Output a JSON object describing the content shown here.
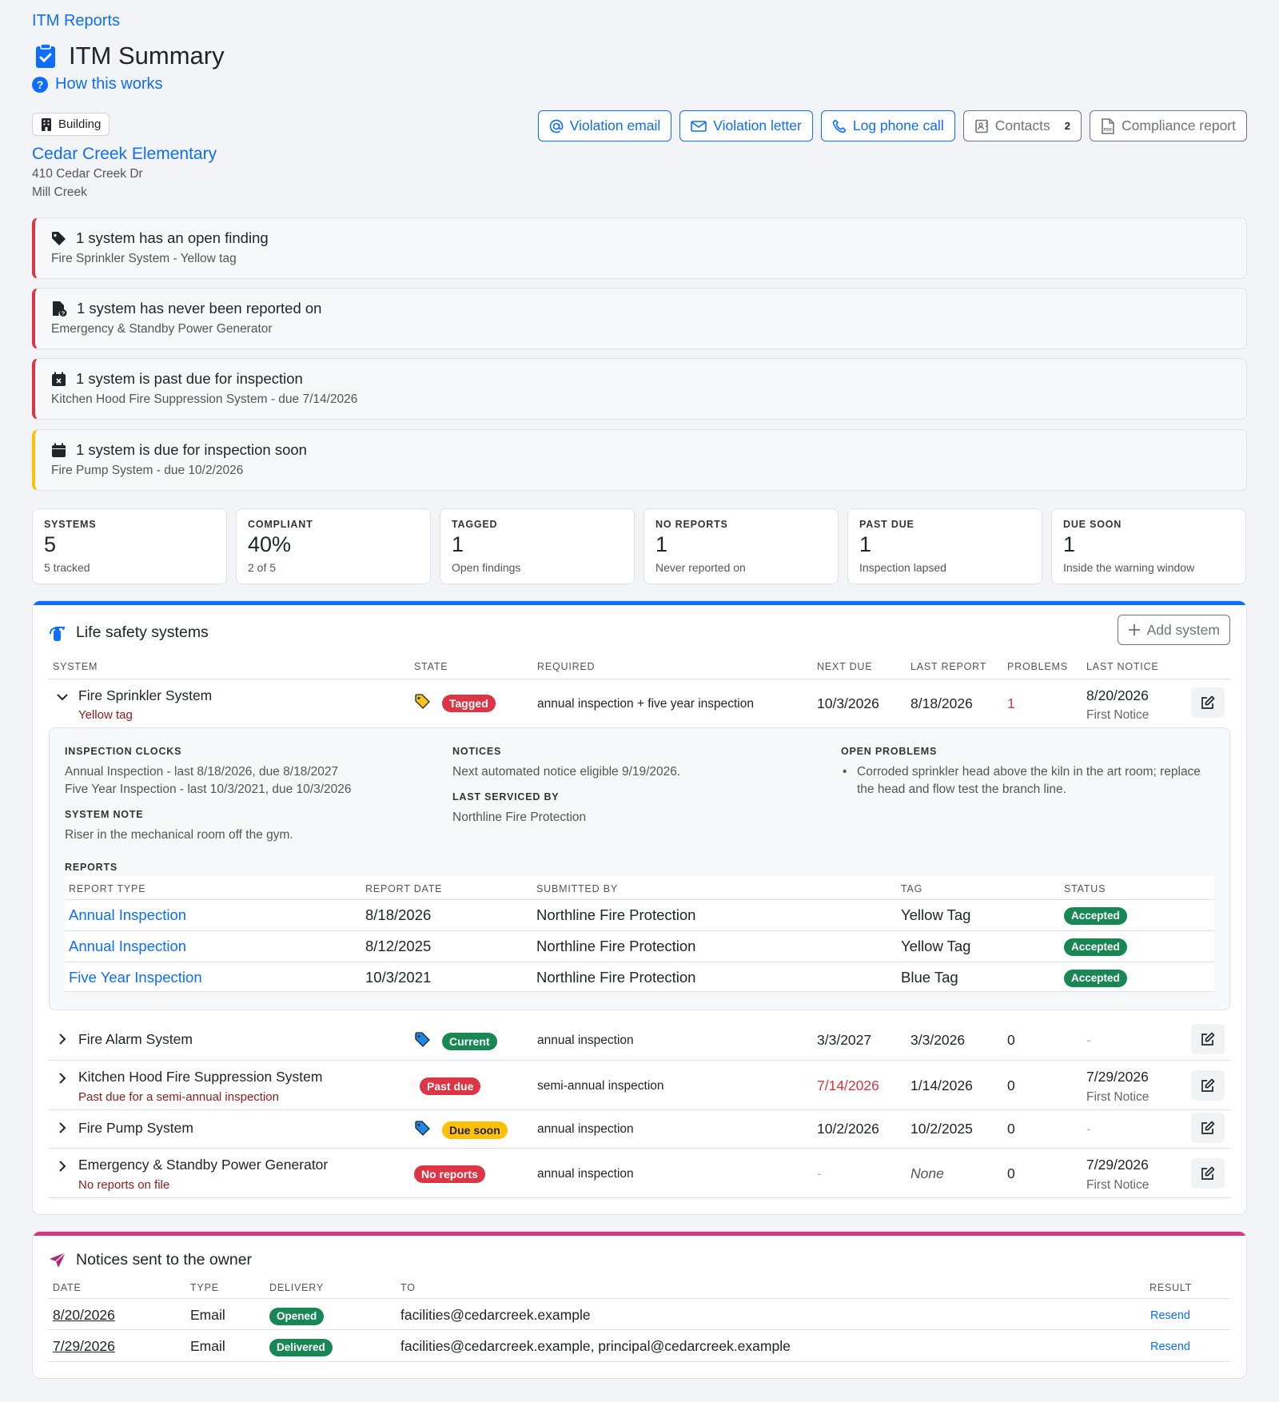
{
  "header": {
    "breadcrumb": "ITM Reports",
    "title": "ITM Summary",
    "how_link": "How this works",
    "building_badge": "Building",
    "building_name": "Cedar Creek Elementary",
    "address_line1": "410 Cedar Creek Dr",
    "address_line2": "Mill Creek"
  },
  "actions": {
    "violation_email": "Violation email",
    "violation_letter": "Violation letter",
    "log_phone_call": "Log phone call",
    "contacts": "Contacts",
    "contacts_count": "2",
    "compliance_report": "Compliance report"
  },
  "alerts": [
    {
      "title": "1 system has an open finding",
      "detail": "Fire Sprinkler System - Yellow tag",
      "icon": "tag-icon",
      "severity": "danger"
    },
    {
      "title": "1 system has never been reported on",
      "detail": "Emergency & Standby Power Generator",
      "icon": "file-question-icon",
      "severity": "danger"
    },
    {
      "title": "1 system is past due for inspection",
      "detail": "Kitchen Hood Fire Suppression System - due 7/14/2026",
      "icon": "calendar-x-icon",
      "severity": "danger"
    },
    {
      "title": "1 system is due for inspection soon",
      "detail": "Fire Pump System - due 10/2/2026",
      "icon": "calendar-icon",
      "severity": "warning"
    }
  ],
  "stats": [
    {
      "label": "SYSTEMS",
      "value": "5",
      "detail": "5 tracked"
    },
    {
      "label": "COMPLIANT",
      "value": "40%",
      "detail": "2 of 5"
    },
    {
      "label": "TAGGED",
      "value": "1",
      "detail": "Open findings"
    },
    {
      "label": "NO REPORTS",
      "value": "1",
      "detail": "Never reported on"
    },
    {
      "label": "PAST DUE",
      "value": "1",
      "detail": "Inspection lapsed"
    },
    {
      "label": "DUE SOON",
      "value": "1",
      "detail": "Inside the warning window"
    }
  ],
  "systems": {
    "title": "Life safety systems",
    "add_button": "Add system",
    "columns": [
      "SYSTEM",
      "STATE",
      "REQUIRED",
      "NEXT DUE",
      "LAST REPORT",
      "PROBLEMS",
      "LAST NOTICE"
    ],
    "rows": [
      {
        "name": "Fire Sprinkler System",
        "sub": "Yellow tag",
        "tag_color": "#f5c518",
        "state": "Tagged",
        "required": "annual inspection + five year inspection",
        "next_due": "10/3/2026",
        "last_report": "8/18/2026",
        "problems": "1",
        "last_notice": "8/20/2026",
        "notice_type": "First Notice"
      },
      {
        "name": "Fire Alarm System",
        "sub": "",
        "tag_color": "#1e88e5",
        "state": "Current",
        "required": "annual inspection",
        "next_due": "3/3/2027",
        "last_report": "3/3/2026",
        "problems": "0",
        "last_notice": "-",
        "notice_type": ""
      },
      {
        "name": "Kitchen Hood Fire Suppression System",
        "sub": "Past due for a semi-annual inspection",
        "tag_color": "",
        "state": "Past due",
        "required": "semi-annual inspection",
        "next_due": "7/14/2026",
        "last_report": "1/14/2026",
        "problems": "0",
        "last_notice": "7/29/2026",
        "notice_type": "First Notice"
      },
      {
        "name": "Fire Pump System",
        "sub": "",
        "tag_color": "#1e88e5",
        "state": "Due soon",
        "required": "annual inspection",
        "next_due": "10/2/2026",
        "last_report": "10/2/2025",
        "problems": "0",
        "last_notice": "-",
        "notice_type": ""
      },
      {
        "name": "Emergency & Standby Power Generator",
        "sub": "No reports on file",
        "tag_color": "",
        "state": "No reports",
        "required": "annual inspection",
        "next_due": "-",
        "last_report": "None",
        "problems": "0",
        "last_notice": "7/29/2026",
        "notice_type": "First Notice"
      }
    ]
  },
  "detail": {
    "clocks_label": "INSPECTION CLOCKS",
    "clocks": [
      "Annual Inspection - last 8/18/2026, due 8/18/2027",
      "Five Year Inspection - last 10/3/2021, due 10/3/2026"
    ],
    "note_label": "SYSTEM NOTE",
    "note": "Riser in the mechanical room off the gym.",
    "notices_label": "NOTICES",
    "notices": "Next automated notice eligible 9/19/2026.",
    "serviced_label": "LAST SERVICED BY",
    "serviced_by": "Northline Fire Protection",
    "problems_label": "OPEN PROBLEMS",
    "problems_line1": "Corroded sprinkler head above the kiln in the art room; replace",
    "problems_line2": "the head and flow test the branch line.",
    "reports_label": "REPORTS",
    "report_columns": [
      "REPORT TYPE",
      "REPORT DATE",
      "SUBMITTED BY",
      "TAG",
      "STATUS"
    ],
    "reports": [
      {
        "type": "Annual Inspection",
        "date": "8/18/2026",
        "by": "Northline Fire Protection",
        "tag": "Yellow Tag",
        "status": "Accepted"
      },
      {
        "type": "Annual Inspection",
        "date": "8/12/2025",
        "by": "Northline Fire Protection",
        "tag": "Yellow Tag",
        "status": "Accepted"
      },
      {
        "type": "Five Year Inspection",
        "date": "10/3/2021",
        "by": "Northline Fire Protection",
        "tag": "Blue Tag",
        "status": "Accepted"
      }
    ]
  },
  "notices": {
    "title": "Notices sent to the owner",
    "columns": [
      "DATE",
      "TYPE",
      "DELIVERY",
      "TO",
      "RESULT"
    ],
    "rows": [
      {
        "date": "8/20/2026",
        "type": "Email",
        "delivery": "Opened",
        "to": "facilities@cedarcreek.example",
        "result": "Resend"
      },
      {
        "date": "7/29/2026",
        "type": "Email",
        "delivery": "Delivered",
        "to": "facilities@cedarcreek.example, principal@cedarcreek.example",
        "result": "Resend"
      }
    ]
  },
  "colors": {
    "accent": "#0d6efd",
    "danger": "#dc3545",
    "warning": "#ffc107",
    "success": "#198754",
    "notices_accent": "#d63384"
  }
}
